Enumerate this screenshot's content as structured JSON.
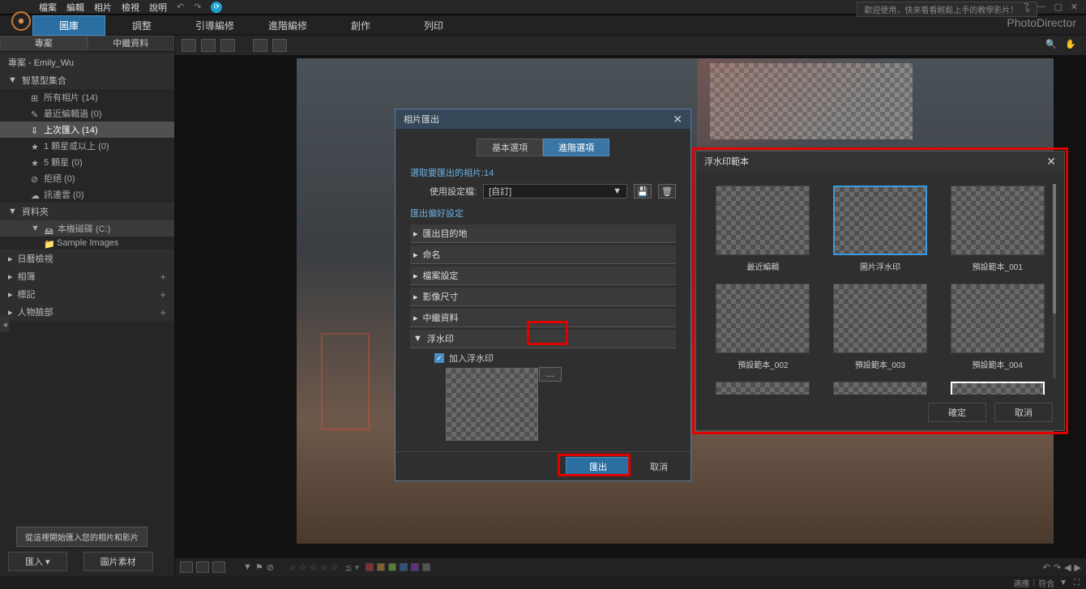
{
  "menubar": {
    "items": [
      "檔案",
      "編輯",
      "相片",
      "檢視",
      "說明"
    ]
  },
  "welcome": "歡迎使用，快來看看輕鬆上手的教學影片！",
  "brand": "PhotoDirector",
  "main_tabs": [
    "圖庫",
    "調整",
    "引導編修",
    "進階編修",
    "創作",
    "列印"
  ],
  "sub_tabs": [
    "專案",
    "中繼資料"
  ],
  "project_name": "專案 - Emily_Wu",
  "tree": {
    "smart_header": "智慧型集合",
    "items": [
      {
        "label": "所有相片 (14)"
      },
      {
        "label": "最近編輯過 (0)"
      },
      {
        "label": "上次匯入 (14)",
        "selected": true
      },
      {
        "label": "1 顆星或以上 (0)"
      },
      {
        "label": "5 顆星 (0)"
      },
      {
        "label": "拒絕 (0)"
      },
      {
        "label": "訊連雲 (0)"
      }
    ],
    "folders_header": "資料夾",
    "disk": "本機磁碟 (C:)",
    "sample": "Sample Images",
    "calendar": "日曆檢視",
    "albums": "相簿",
    "tags": "標記",
    "faces": "人物臉部"
  },
  "import_hint": "從這裡開始匯入您的相片和影片",
  "bottom_buttons": {
    "import": "匯入",
    "stock": "圖片素材"
  },
  "statusbar_right": {
    "adapt": "適應",
    "fit": "符合"
  },
  "dialog": {
    "title": "相片匯出",
    "tabs": {
      "basic": "基本選項",
      "advanced": "進階選項"
    },
    "select_label": "選取要匯出的相片:14",
    "profile_label": "使用設定檔:",
    "profile_value": "[自訂]",
    "pref_header": "匯出偏好設定",
    "sections": [
      "匯出目的地",
      "命名",
      "檔案設定",
      "影像尺寸",
      "中繼資料",
      "浮水印"
    ],
    "watermark_check": "加入浮水印",
    "export_btn": "匯出",
    "cancel_btn": "取消"
  },
  "wm_dialog": {
    "title": "浮水印範本",
    "templates": [
      "最近編輯",
      "圖片浮水印",
      "預設範本_001",
      "預設範本_002",
      "預設範本_003",
      "預設範本_004"
    ],
    "ok": "確定",
    "cancel": "取消"
  }
}
